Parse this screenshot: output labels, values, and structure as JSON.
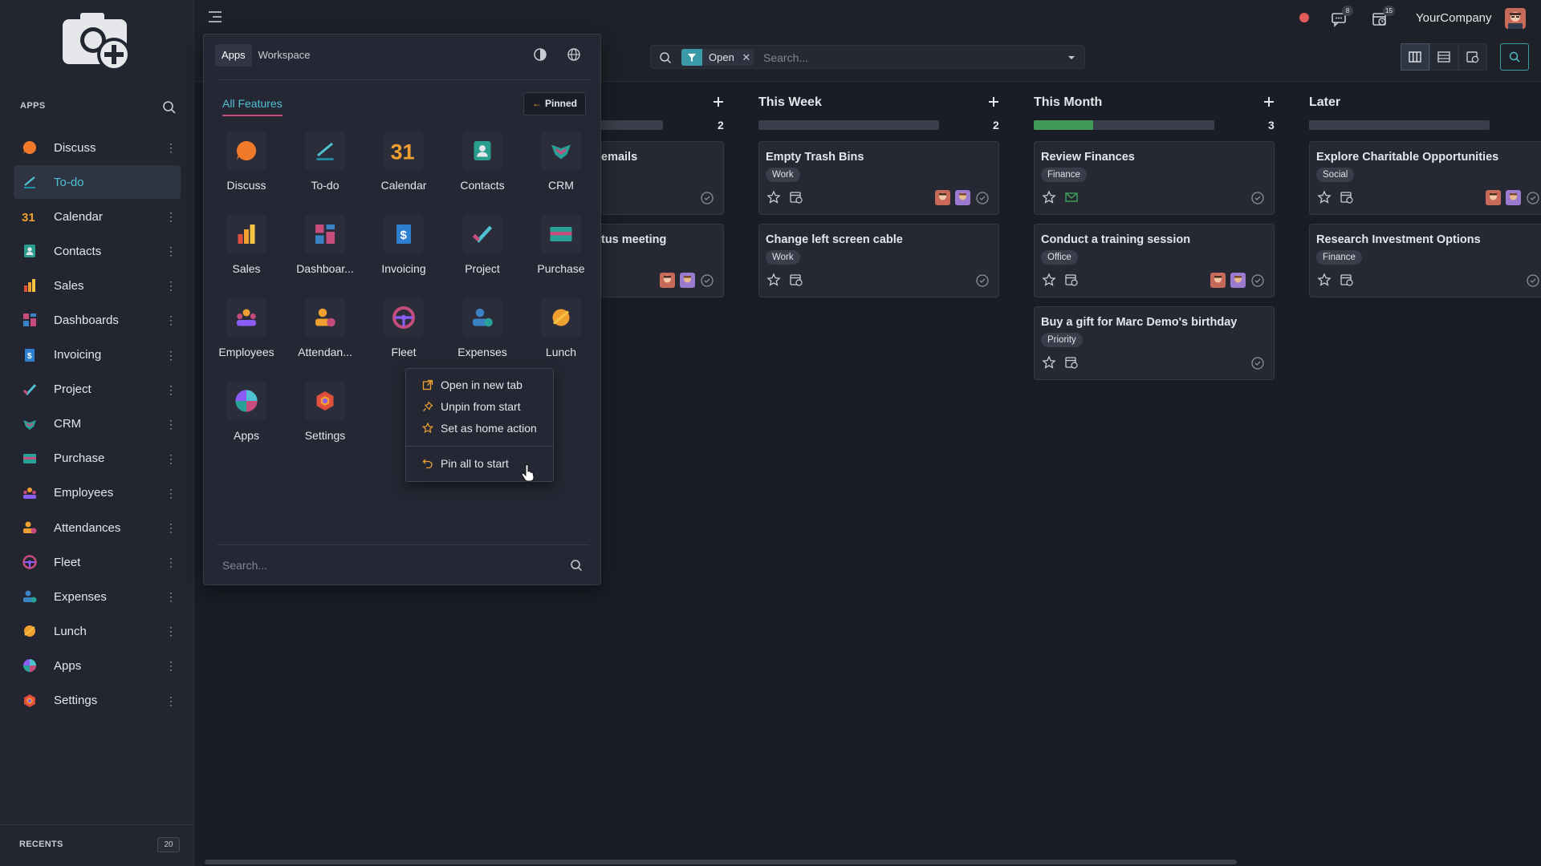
{
  "sidebar": {
    "section_title": "APPS",
    "items": [
      {
        "label": "Discuss",
        "icon": "discuss-icon"
      },
      {
        "label": "To-do",
        "icon": "todo-icon",
        "active": true
      },
      {
        "label": "Calendar",
        "icon": "calendar-icon"
      },
      {
        "label": "Contacts",
        "icon": "contacts-icon"
      },
      {
        "label": "Sales",
        "icon": "sales-icon"
      },
      {
        "label": "Dashboards",
        "icon": "dashboards-icon"
      },
      {
        "label": "Invoicing",
        "icon": "invoicing-icon"
      },
      {
        "label": "Project",
        "icon": "project-icon"
      },
      {
        "label": "CRM",
        "icon": "crm-icon"
      },
      {
        "label": "Purchase",
        "icon": "purchase-icon"
      },
      {
        "label": "Employees",
        "icon": "employees-icon"
      },
      {
        "label": "Attendances",
        "icon": "attendances-icon"
      },
      {
        "label": "Fleet",
        "icon": "fleet-icon"
      },
      {
        "label": "Expenses",
        "icon": "expenses-icon"
      },
      {
        "label": "Lunch",
        "icon": "lunch-icon"
      },
      {
        "label": "Apps",
        "icon": "apps-icon"
      },
      {
        "label": "Settings",
        "icon": "settings-icon"
      }
    ],
    "recents_label": "RECENTS",
    "recents_count": "20"
  },
  "topbar": {
    "messages_badge": "8",
    "activities_badge": "15",
    "company": "YourCompany"
  },
  "search": {
    "facet_label": "Open",
    "placeholder": "Search..."
  },
  "launcher": {
    "tabs": [
      "Apps",
      "Workspace"
    ],
    "all_features": "All Features",
    "pinned_label": "Pinned",
    "apps": [
      "Discuss",
      "To-do",
      "Calendar",
      "Contacts",
      "CRM",
      "Sales",
      "Dashboar...",
      "Invoicing",
      "Project",
      "Purchase",
      "Employees",
      "Attendan...",
      "Fleet",
      "Expenses",
      "Lunch",
      "Apps",
      "Settings"
    ],
    "search_placeholder": "Search..."
  },
  "context_menu": {
    "items": [
      "Open in new tab",
      "Unpin from start",
      "Set as home action",
      "Pin all to start"
    ]
  },
  "kanban": {
    "columns": [
      {
        "title": "",
        "count": "2",
        "progress": 0,
        "cards": [
          {
            "title": "emails",
            "tag": ""
          },
          {
            "title": "tus meeting",
            "tag": ""
          }
        ]
      },
      {
        "title": "This Week",
        "count": "2",
        "progress": 0,
        "cards": [
          {
            "title": "Empty Trash Bins",
            "tag": "Work"
          },
          {
            "title": "Change left screen cable",
            "tag": "Work"
          }
        ]
      },
      {
        "title": "This Month",
        "count": "3",
        "progress": 0.33,
        "cards": [
          {
            "title": "Review Finances",
            "tag": "Finance"
          },
          {
            "title": "Conduct a training session",
            "tag": "Office"
          },
          {
            "title": "Buy a gift for Marc Demo's birthday",
            "tag": "Priority"
          }
        ]
      },
      {
        "title": "Later",
        "count": "",
        "progress": 0,
        "cards": [
          {
            "title": "Explore Charitable Opportunities",
            "tag": "Social"
          },
          {
            "title": "Research Investment Options",
            "tag": "Finance"
          }
        ]
      }
    ]
  },
  "colors": {
    "accent": "#4fc1d3",
    "progress_green": "#3e9a56",
    "record_dot": "#e25a5a"
  }
}
